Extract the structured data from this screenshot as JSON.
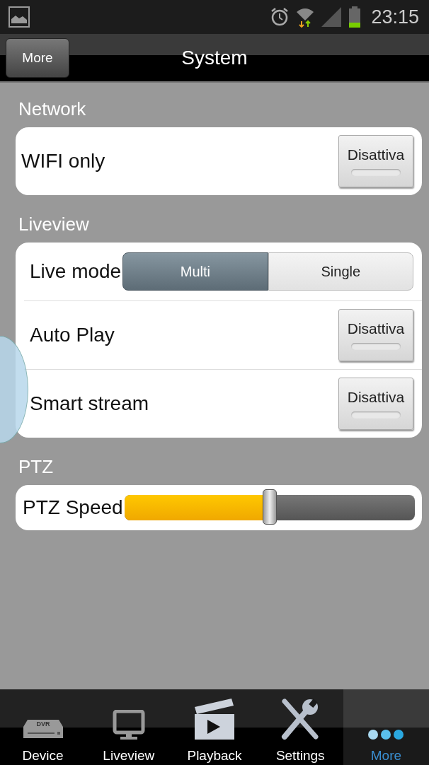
{
  "status_bar": {
    "time": "23:15"
  },
  "header": {
    "back_button": "More",
    "title": "System"
  },
  "sections": [
    {
      "title": "Network",
      "rows": [
        {
          "kind": "toggle",
          "label": "WIFI only",
          "button": "Disattiva",
          "on": false
        }
      ]
    },
    {
      "title": "Liveview",
      "rows": [
        {
          "kind": "segmented",
          "label": "Live mode",
          "options": [
            {
              "label": "Multi",
              "selected": true
            },
            {
              "label": "Single",
              "selected": false
            }
          ]
        },
        {
          "kind": "toggle",
          "label": "Auto Play",
          "button": "Disattiva",
          "on": false
        },
        {
          "kind": "toggle",
          "label": "Smart stream",
          "button": "Disattiva",
          "on": false
        }
      ]
    },
    {
      "title": "PTZ",
      "rows": [
        {
          "kind": "slider",
          "label": "PTZ Speed",
          "level": 0.5
        }
      ]
    }
  ],
  "tab_bar": [
    {
      "label": "Device",
      "icon_text": "DVR",
      "selected": false
    },
    {
      "label": "Liveview",
      "selected": false
    },
    {
      "label": "Playback",
      "selected": false
    },
    {
      "label": "Settings",
      "selected": false
    },
    {
      "label": "More",
      "selected": true
    }
  ]
}
